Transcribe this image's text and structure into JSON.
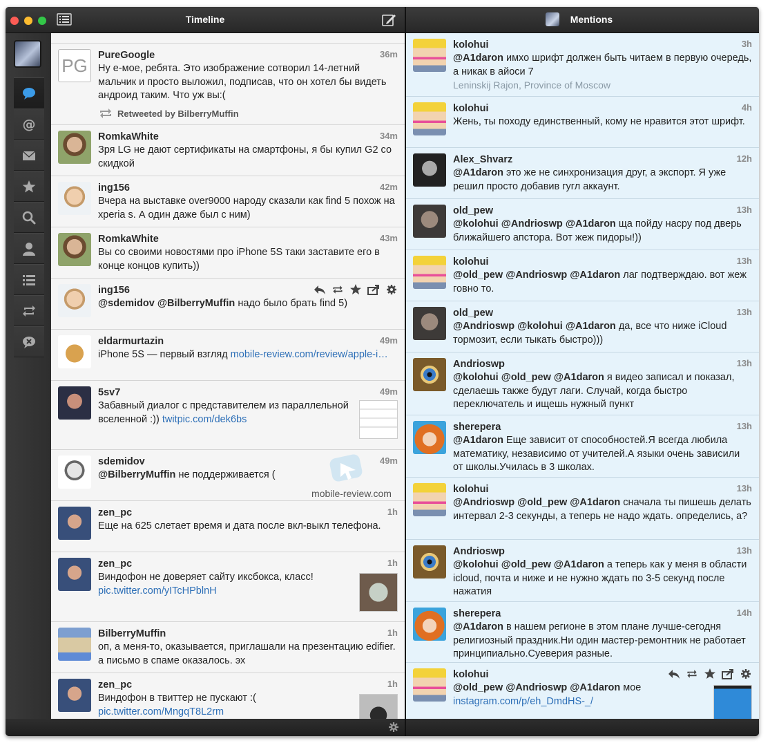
{
  "left": {
    "title": "Timeline",
    "tweets": [
      {
        "name": "PureGoogle",
        "time": "36m",
        "avatar": "PG",
        "text": "Ну е-мое, ребята. Это изображение сотворил 14-летний мальчик и просто выложил, подписав, что он хотел бы видеть андроид таким. Что уж вы:(",
        "retweeted": "Retweeted by BilberryMuffin"
      },
      {
        "name": "RomkaWhite",
        "time": "34m",
        "text": "Зря LG не дают сертификаты на смартфоны, я бы купил G2 со скидкой"
      },
      {
        "name": "ing156",
        "time": "42m",
        "text": "Вчера на выставке over9000 народу сказали как find 5 похож на xperia s. А один даже был с ним)"
      },
      {
        "name": "RomkaWhite",
        "time": "43m",
        "text": "Вы со своими новостями про iPhone 5S таки заставите его в конце концов купить))"
      },
      {
        "name": "ing156",
        "mention1": "@sdemidov",
        "mention2": "@BilberryMuffin",
        "text": "надо было брать find 5)"
      },
      {
        "name": "eldarmurtazin",
        "time": "49m",
        "text": "iPhone 5S — первый взгляд",
        "link": "mobile-review.com/review/apple-i…"
      },
      {
        "name": "5sv7",
        "time": "49m",
        "text": "Забавный диалог с представителем из параллельной вселенной :))",
        "link": "twitpic.com/dek6bs"
      },
      {
        "name": "sdemidov",
        "time": "49m",
        "mention1": "@BilberryMuffin",
        "text": "не поддерживается ("
      },
      {
        "name": "zen_pc",
        "time": "1h",
        "text": "Еще на 625 слетает время и дата после вкл-выкл телефона."
      },
      {
        "name": "zen_pc",
        "time": "1h",
        "text": "Виндофон не доверяет сайту иксбокса, класс!",
        "link": "pic.twitter.com/yITcHPblnH"
      },
      {
        "name": "BilberryMuffin",
        "time": "1h",
        "text": "оп, а меня-то, оказывается, приглашали на презентацию edifier. а письмо в спаме оказалось. эх"
      },
      {
        "name": "zen_pc",
        "time": "1h",
        "text": "Виндофон в твиттер не пускают :(",
        "link": "pic.twitter.com/MngqT8L2rm"
      }
    ]
  },
  "right": {
    "title": "Mentions",
    "tweets": [
      {
        "name": "kolohui",
        "time": "3h",
        "m": [
          "@A1daron"
        ],
        "text": "имхо шрифт должен быть читаем в первую очередь, а никак в айоси 7",
        "loc": "Leninskij Rajon, Province of Moscow"
      },
      {
        "name": "kolohui",
        "time": "4h",
        "text": "Жень, ты походу единственный, кому не нравится этот шрифт."
      },
      {
        "name": "Alex_Shvarz",
        "time": "12h",
        "m": [
          "@A1daron"
        ],
        "text": "это же не синхронизация друг, а экспорт. Я уже решил просто добавив гугл аккаунт."
      },
      {
        "name": "old_pew",
        "time": "13h",
        "m": [
          "@kolohui",
          "@Andrioswp",
          "@A1daron"
        ],
        "text": "ща пойду насру под дверь ближайшего апстора. Вот жеж пидоры!))"
      },
      {
        "name": "kolohui",
        "time": "13h",
        "m": [
          "@old_pew",
          "@Andrioswp",
          "@A1daron"
        ],
        "text": "лаг подтверждаю. вот жеж говно то."
      },
      {
        "name": "old_pew",
        "time": "13h",
        "m": [
          "@Andrioswp",
          "@kolohui",
          "@A1daron"
        ],
        "text": "да, все что ниже iCloud тормозит, если тыкать быстро)))"
      },
      {
        "name": "Andrioswp",
        "time": "13h",
        "m": [
          "@kolohui",
          "@old_pew",
          "@A1daron"
        ],
        "text": "я видео записал и показал, сделаешь также будут лаги. Случай, когда быстро переключатель и ищешь нужный пункт"
      },
      {
        "name": "sherepera",
        "time": "13h",
        "m": [
          "@A1daron"
        ],
        "text": "Еще зависит от способностей.Я всегда любила математику, независимо от учителей.А языки очень зависили от школы.Училась в 3 школах."
      },
      {
        "name": "kolohui",
        "time": "13h",
        "m": [
          "@Andrioswp",
          "@old_pew",
          "@A1daron"
        ],
        "text": "сначала ты пишешь делать интервал 2-3 секунды, а теперь не надо ждать. определись, а?"
      },
      {
        "name": "Andrioswp",
        "time": "13h",
        "m": [
          "@kolohui",
          "@old_pew",
          "@A1daron"
        ],
        "text": "а теперь как у меня в области icloud, почта  и ниже и не нужно ждать по 3-5 секунд после нажатия"
      },
      {
        "name": "sherepera",
        "time": "14h",
        "m": [
          "@A1daron"
        ],
        "text": "в нашем регионе в этом плане лучше-сегодня религиозный праздник.Ни один мастер-ремонтник не работает принципиально.Суеверия разные."
      },
      {
        "name": "kolohui",
        "m": [
          "@old_pew",
          "@Andrioswp",
          "@A1daron"
        ],
        "text": "мое",
        "link": "instagram.com/p/eh_DmdHS-_/"
      }
    ]
  },
  "watermark": "mobile-review.com"
}
